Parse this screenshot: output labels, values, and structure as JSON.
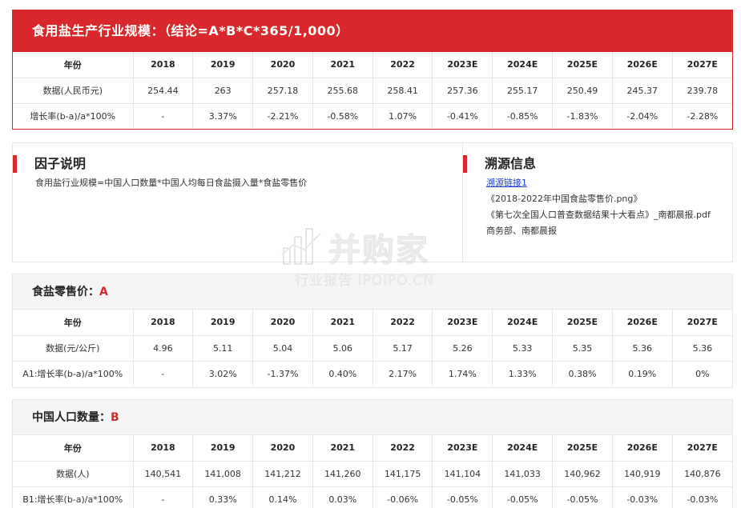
{
  "top": {
    "title": "食用盐生产行业规模：（结论=A*B*C*365/1,000）",
    "row_label_year": "年份",
    "years": [
      "2018",
      "2019",
      "2020",
      "2021",
      "2022",
      "2023E",
      "2024E",
      "2025E",
      "2026E",
      "2027E"
    ],
    "row_label_data": "数据(人民币元)",
    "data": [
      "254.44",
      "263",
      "257.18",
      "255.68",
      "258.41",
      "257.36",
      "255.17",
      "250.49",
      "245.37",
      "239.78"
    ],
    "row_label_growth": "增长率(b-a)/a*100%",
    "growth": [
      "-",
      "3.37%",
      "-2.21%",
      "-0.58%",
      "1.07%",
      "-0.41%",
      "-0.85%",
      "-1.83%",
      "-2.04%",
      "-2.28%"
    ]
  },
  "factor": {
    "title": "因子说明",
    "text": "食用盐行业规模=中国人口数量*中国人均每日食盐摄入量*食盐零售价"
  },
  "source": {
    "title": "溯源信息",
    "link": "溯源链接1",
    "item1": "《2018-2022年中国食盐零售价.png》",
    "item2": "《第七次全国人口普查数据结果十大看点》_南都晨报.pdf",
    "item3": "商务部、南都晨报"
  },
  "table_a": {
    "title": "食盐零售价：",
    "var": "A",
    "row_label_year": "年份",
    "years": [
      "2018",
      "2019",
      "2020",
      "2021",
      "2022",
      "2023E",
      "2024E",
      "2025E",
      "2026E",
      "2027E"
    ],
    "row_label_data": "数据(元/公斤)",
    "data": [
      "4.96",
      "5.11",
      "5.04",
      "5.06",
      "5.17",
      "5.26",
      "5.33",
      "5.35",
      "5.36",
      "5.36"
    ],
    "row_label_growth": "A1:增长率(b-a)/a*100%",
    "growth": [
      "-",
      "3.02%",
      "-1.37%",
      "0.40%",
      "2.17%",
      "1.74%",
      "1.33%",
      "0.38%",
      "0.19%",
      "0%"
    ]
  },
  "table_b": {
    "title": "中国人口数量：",
    "var": "B",
    "row_label_year": "年份",
    "years": [
      "2018",
      "2019",
      "2020",
      "2021",
      "2022",
      "2023E",
      "2024E",
      "2025E",
      "2026E",
      "2027E"
    ],
    "row_label_data": "数据(人)",
    "data": [
      "140,541",
      "141,008",
      "141,212",
      "141,260",
      "141,175",
      "141,104",
      "141,033",
      "140,962",
      "140,919",
      "140,876"
    ],
    "row_label_growth": "B1:增长率(b-a)/a*100%",
    "growth": [
      "-",
      "0.33%",
      "0.14%",
      "0.03%",
      "-0.06%",
      "-0.05%",
      "-0.05%",
      "-0.05%",
      "-0.03%",
      "-0.03%"
    ]
  },
  "watermark": {
    "name": "并购家",
    "sub": "行业报告 IPOIPO.CN"
  },
  "colors": {
    "accent": "#d8282b",
    "link": "#1a3ec9",
    "header_bg": "#f5f5f5"
  }
}
